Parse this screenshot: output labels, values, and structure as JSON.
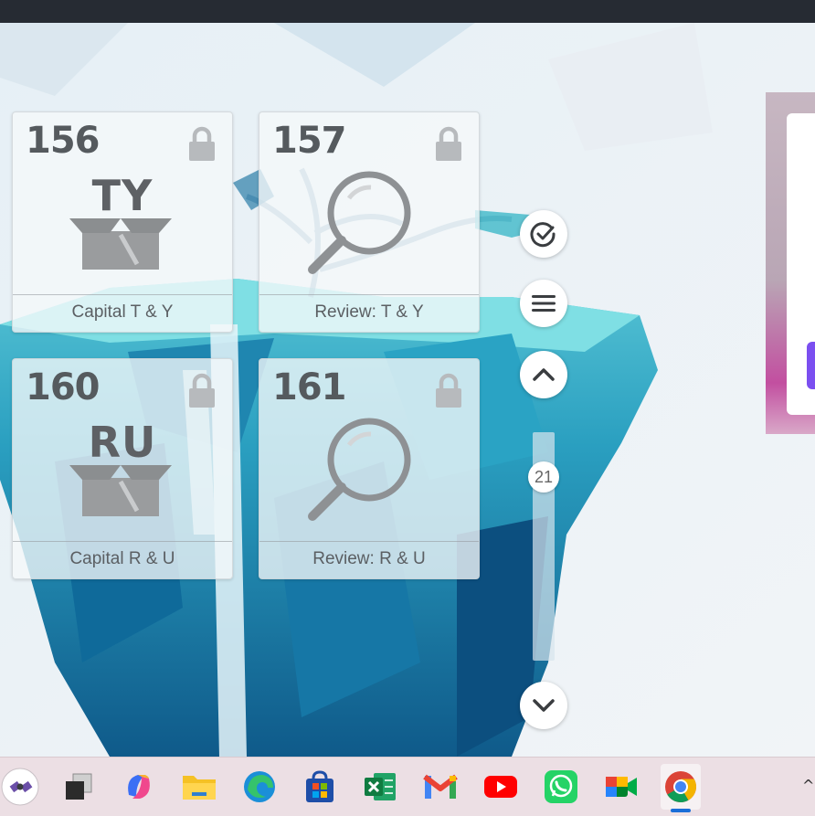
{
  "cards": [
    {
      "number": "156",
      "letters": "TY",
      "label": "Capital T & Y",
      "kind": "box",
      "locked": true
    },
    {
      "number": "157",
      "letters": "",
      "label": "Review: T & Y",
      "kind": "search",
      "locked": true
    },
    {
      "number": "160",
      "letters": "RU",
      "label": "Capital R & U",
      "kind": "box",
      "locked": true
    },
    {
      "number": "161",
      "letters": "",
      "label": "Review: R & U",
      "kind": "search",
      "locked": true
    }
  ],
  "controls": {
    "check_icon": "check-circle-icon",
    "menu_icon": "hamburger-menu-icon",
    "up_icon": "chevron-up-icon",
    "down_icon": "chevron-down-icon",
    "scroll_value": "21"
  },
  "taskbar": {
    "apps": [
      "satellite-app",
      "task-view",
      "copilot",
      "file-explorer",
      "edge",
      "microsoft-store",
      "excel",
      "gmail",
      "youtube",
      "whatsapp",
      "google-meet",
      "chrome"
    ],
    "active_app": "chrome",
    "tray_glyph": "^"
  },
  "colors": {
    "topbar": "#262b33",
    "card_text": "#555a5e",
    "accent_purple": "#7b4ff0",
    "taskbar": "#ecdfe4",
    "active_indicator": "#1a6ed8"
  }
}
